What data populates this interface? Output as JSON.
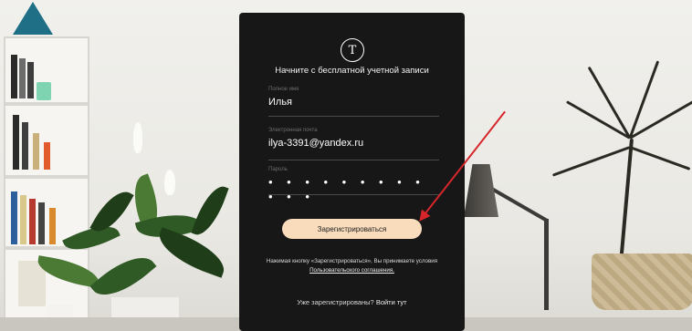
{
  "form": {
    "heading": "Начните с бесплатной учетной записи",
    "name_label": "Полное имя",
    "name_value": "Илья",
    "email_label": "Электронная почта",
    "email_value": "ilya-3391@yandex.ru",
    "password_label": "Пароль",
    "password_mask": "• • • • • • • • • • • •",
    "submit_label": "Зарегистрироваться",
    "terms_text": "Нажимая кнопку «Зарегистрироваться», Вы принимаете условия",
    "terms_link": "Пользовательского соглашения.",
    "already_text": "Уже зарегистрированы?",
    "login_link": "Войти тут"
  },
  "colors": {
    "card_bg": "#171717",
    "button_bg": "#f8dcbc",
    "annotation_arrow": "#d6262b"
  },
  "icons": {
    "logo": "tilda-logo",
    "annotation": "red-arrow"
  }
}
